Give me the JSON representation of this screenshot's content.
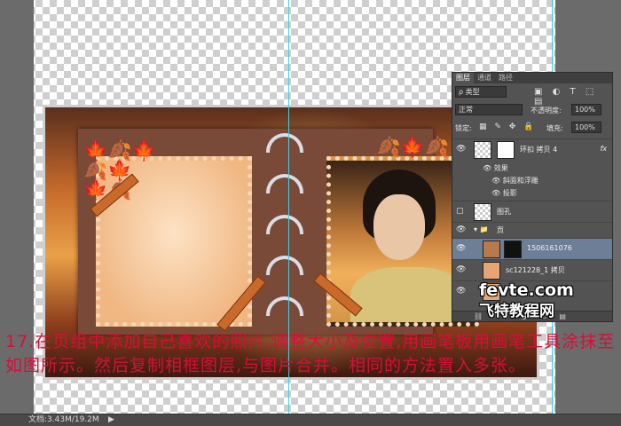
{
  "layers_panel": {
    "tabs": [
      "图层",
      "通道",
      "路径"
    ],
    "filter_kind": "ρ 类型",
    "filter_icons": "▣ ◐ T ⬚ ▤",
    "blend_mode": "正常",
    "opacity_label": "不透明度:",
    "opacity_value": "100%",
    "lock_label": "锁定:",
    "lock_icons": "▦ ✎ ✥ 🔒",
    "fill_label": "填充:",
    "fill_value": "100%",
    "layers": [
      {
        "name": "环扣 拷贝 4",
        "fx": "fx"
      },
      {
        "name": "图孔"
      },
      {
        "name": "页"
      },
      {
        "name": "1506161076"
      },
      {
        "name": "sc121228_1 拷贝"
      }
    ],
    "effects_label": "效果",
    "effect_bevel": "斜面和浮雕",
    "effect_shadow": "投影",
    "bottom_icons": "⛓ fx ◑ ▭ ▤"
  },
  "caption": "17.在页组中添加自己喜欢的照片,调整大小及位置,用画笔板用画笔工具涂抹至如图所示。然后复制相框图层,与图片合并。相同的方法置入多张。",
  "status": {
    "doc": "文档:3.43M/19.2M",
    "arrow": "▶"
  },
  "watermark": {
    "line1": "fevte.com",
    "line2": "飞特教程网"
  },
  "colors": {
    "caption": "#d60f3a",
    "guide": "#3fd0e6",
    "selected_layer": "#6d7f96"
  }
}
